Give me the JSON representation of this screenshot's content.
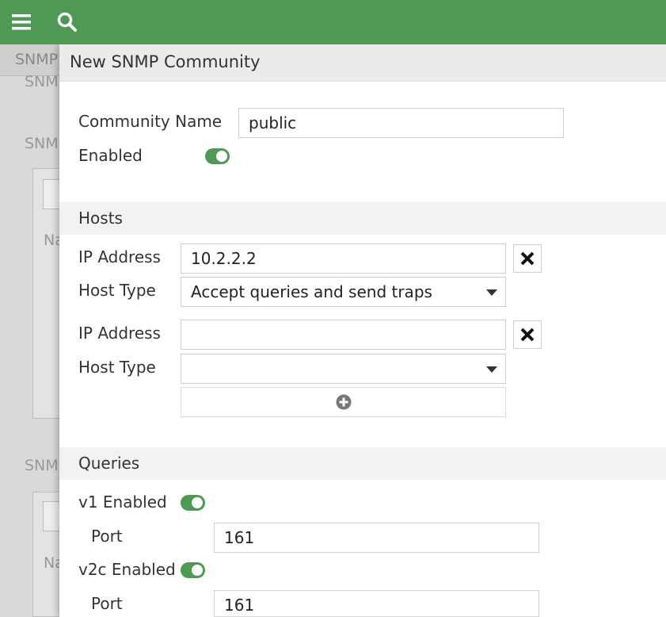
{
  "topbar": {
    "menu_icon": "hamburger-menu-icon",
    "search_icon": "search-icon",
    "background_color": "#4e9a54"
  },
  "background_page": {
    "breadcrumb": "SNMP",
    "fragments": [
      "SNM",
      "SNM",
      "Na",
      "SNM",
      "Na"
    ]
  },
  "panel": {
    "title": "New SNMP Community",
    "community_name_label": "Community Name",
    "community_name_value": "public",
    "enabled_label": "Enabled",
    "enabled_on": true
  },
  "hosts": {
    "section_title": "Hosts",
    "rows": [
      {
        "ip_label": "IP Address",
        "ip_value": "10.2.2.2",
        "host_type_label": "Host Type",
        "host_type_value": "Accept queries and send traps"
      },
      {
        "ip_label": "IP Address",
        "ip_value": "",
        "host_type_label": "Host Type",
        "host_type_value": ""
      }
    ],
    "remove_icon": "close-x-icon",
    "add_icon": "plus-circle-icon"
  },
  "queries": {
    "section_title": "Queries",
    "v1_label": "v1 Enabled",
    "v1_on": true,
    "v1_port_label": "Port",
    "v1_port_value": "161",
    "v2c_label": "v2c Enabled",
    "v2c_on": true,
    "v2c_port_label": "Port",
    "v2c_port_value": "161"
  },
  "colors": {
    "accent_green": "#4e9a54",
    "section_bg": "#f2f2f2",
    "header_bg": "#ebebeb"
  }
}
